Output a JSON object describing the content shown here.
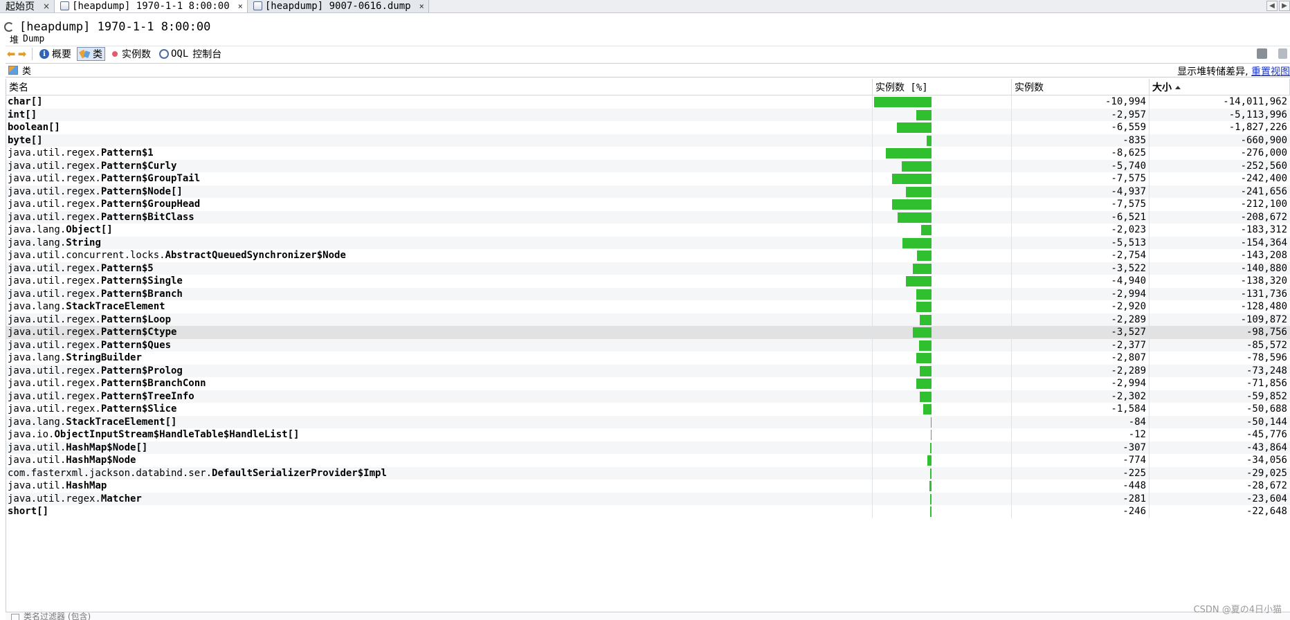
{
  "tabs": [
    {
      "label": "起始页",
      "close": "×",
      "active": false
    },
    {
      "label": "[heapdump] 1970-1-1 8:00:00",
      "close": "×",
      "active": true
    },
    {
      "label": "[heapdump] 9007-0616.dump",
      "close": "×",
      "active": false
    }
  ],
  "tab_nav": {
    "left": "◀",
    "right": "▶"
  },
  "document": {
    "title": "[heapdump] 1970-1-1 8:00:00",
    "section_cn": "堆",
    "section_en": "Dump"
  },
  "toolbar": {
    "summary": "概要",
    "classes": "类",
    "instances": "实例数",
    "oql_prefix": "OQL",
    "oql_label": "控制台"
  },
  "panel": {
    "title": "类",
    "right_text": "显示堆转储差异,",
    "right_link": "重置视图"
  },
  "table": {
    "headers": {
      "class_name": "类名",
      "instances_pct": "实例数 [%]",
      "instances": "实例数",
      "size": "大小"
    },
    "rows": [
      {
        "pkg": "",
        "cls": "char[]",
        "count": "-10,994",
        "size": "-14,011,962",
        "pct": 1.0
      },
      {
        "pkg": "",
        "cls": "int[]",
        "count": "-2,957",
        "size": "-5,113,996",
        "pct": 0.27
      },
      {
        "pkg": "",
        "cls": "boolean[]",
        "count": "-6,559",
        "size": "-1,827,226",
        "pct": 0.6
      },
      {
        "pkg": "",
        "cls": "byte[]",
        "count": "-835",
        "size": "-660,900",
        "pct": 0.08
      },
      {
        "pkg": "java.util.regex.",
        "cls": "Pattern$1",
        "count": "-8,625",
        "size": "-276,000",
        "pct": 0.79
      },
      {
        "pkg": "java.util.regex.",
        "cls": "Pattern$Curly",
        "count": "-5,740",
        "size": "-252,560",
        "pct": 0.52
      },
      {
        "pkg": "java.util.regex.",
        "cls": "Pattern$GroupTail",
        "count": "-7,575",
        "size": "-242,400",
        "pct": 0.69
      },
      {
        "pkg": "java.util.regex.",
        "cls": "Pattern$Node[]",
        "count": "-4,937",
        "size": "-241,656",
        "pct": 0.45
      },
      {
        "pkg": "java.util.regex.",
        "cls": "Pattern$GroupHead",
        "count": "-7,575",
        "size": "-212,100",
        "pct": 0.69
      },
      {
        "pkg": "java.util.regex.",
        "cls": "Pattern$BitClass",
        "count": "-6,521",
        "size": "-208,672",
        "pct": 0.59
      },
      {
        "pkg": "java.lang.",
        "cls": "Object[]",
        "count": "-2,023",
        "size": "-183,312",
        "pct": 0.18
      },
      {
        "pkg": "java.lang.",
        "cls": "String",
        "count": "-5,513",
        "size": "-154,364",
        "pct": 0.5
      },
      {
        "pkg": "java.util.concurrent.locks.",
        "cls": "AbstractQueuedSynchronizer$Node",
        "count": "-2,754",
        "size": "-143,208",
        "pct": 0.25
      },
      {
        "pkg": "java.util.regex.",
        "cls": "Pattern$5",
        "count": "-3,522",
        "size": "-140,880",
        "pct": 0.32
      },
      {
        "pkg": "java.util.regex.",
        "cls": "Pattern$Single",
        "count": "-4,940",
        "size": "-138,320",
        "pct": 0.45
      },
      {
        "pkg": "java.util.regex.",
        "cls": "Pattern$Branch",
        "count": "-2,994",
        "size": "-131,736",
        "pct": 0.27
      },
      {
        "pkg": "java.lang.",
        "cls": "StackTraceElement",
        "count": "-2,920",
        "size": "-128,480",
        "pct": 0.27
      },
      {
        "pkg": "java.util.regex.",
        "cls": "Pattern$Loop",
        "count": "-2,289",
        "size": "-109,872",
        "pct": 0.21
      },
      {
        "pkg": "java.util.regex.",
        "cls": "Pattern$Ctype",
        "count": "-3,527",
        "size": "-98,756",
        "pct": 0.32,
        "selected": true
      },
      {
        "pkg": "java.util.regex.",
        "cls": "Pattern$Ques",
        "count": "-2,377",
        "size": "-85,572",
        "pct": 0.22
      },
      {
        "pkg": "java.lang.",
        "cls": "StringBuilder",
        "count": "-2,807",
        "size": "-78,596",
        "pct": 0.26
      },
      {
        "pkg": "java.util.regex.",
        "cls": "Pattern$Prolog",
        "count": "-2,289",
        "size": "-73,248",
        "pct": 0.21
      },
      {
        "pkg": "java.util.regex.",
        "cls": "Pattern$BranchConn",
        "count": "-2,994",
        "size": "-71,856",
        "pct": 0.27
      },
      {
        "pkg": "java.util.regex.",
        "cls": "Pattern$TreeInfo",
        "count": "-2,302",
        "size": "-59,852",
        "pct": 0.21
      },
      {
        "pkg": "java.util.regex.",
        "cls": "Pattern$Slice",
        "count": "-1,584",
        "size": "-50,688",
        "pct": 0.14
      },
      {
        "pkg": "java.lang.",
        "cls": "StackTraceElement[]",
        "count": "-84",
        "size": "-50,144",
        "pct": 0.008
      },
      {
        "pkg": "java.io.",
        "cls": "ObjectInputStream$HandleTable$HandleList[]",
        "count": "-12",
        "size": "-45,776",
        "pct": 0.002
      },
      {
        "pkg": "java.util.",
        "cls": "HashMap$Node[]",
        "count": "-307",
        "size": "-43,864",
        "pct": 0.028
      },
      {
        "pkg": "java.util.",
        "cls": "HashMap$Node",
        "count": "-774",
        "size": "-34,056",
        "pct": 0.07
      },
      {
        "pkg": "com.fasterxml.jackson.databind.ser.",
        "cls": "DefaultSerializerProvider$Impl",
        "count": "-225",
        "size": "-29,025",
        "pct": 0.02
      },
      {
        "pkg": "java.util.",
        "cls": "HashMap",
        "count": "-448",
        "size": "-28,672",
        "pct": 0.04
      },
      {
        "pkg": "java.util.regex.",
        "cls": "Matcher",
        "count": "-281",
        "size": "-23,604",
        "pct": 0.026
      },
      {
        "pkg": "",
        "cls": "short[]",
        "count": "-246",
        "size": "-22,648",
        "pct": 0.02
      }
    ]
  },
  "filter": {
    "label": "类名过滤器 (包含)"
  },
  "watermark": "CSDN @夏の4日小猫",
  "colors": {
    "bar": "#2fbf2f",
    "link": "#1a35c9",
    "selected_row": "#e2e2e2"
  }
}
